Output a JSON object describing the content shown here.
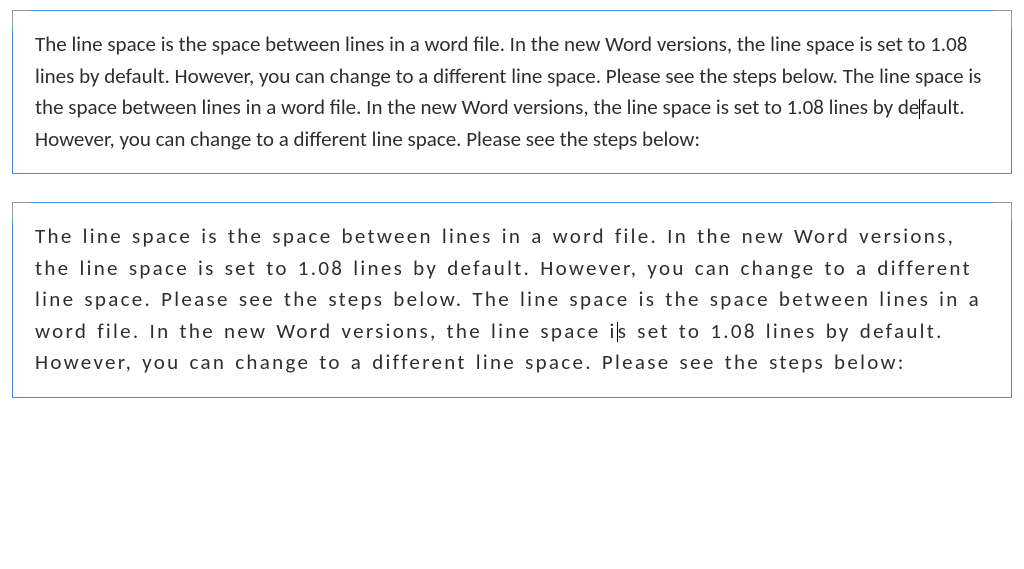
{
  "box1": {
    "text_before_cursor": "The line space is the space between lines in a word file. In the new Word versions, the line space is set to 1.08 lines by default. However, you can change to a different line space. Please see the steps below. The line space is the space between lines in a word file. In the new Word versions, the line space is set to 1.08 lines by de",
    "text_after_cursor": "fault. However, you can change to a different line space. Please see the steps below:"
  },
  "box2": {
    "text_before_cursor": "The line space is the space between lines in a word file. In the new Word versions, the line space is set to 1.08 lines by default. However, you can change to a different line space. Please see the steps below. The line space is the space between lines in a word file. In the new Word versions, the line space i",
    "text_after_cursor": "s set to 1.08 lines by default. However, you can change to a different line space. Please see the steps below:"
  }
}
